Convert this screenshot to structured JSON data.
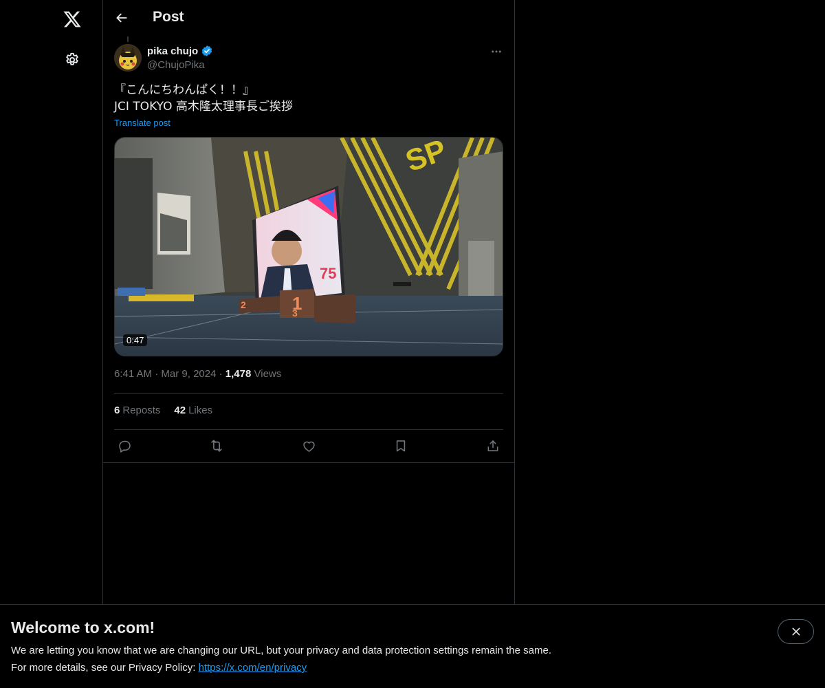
{
  "nav": {
    "logo_icon": "x-logo-icon",
    "settings_icon": "gear-icon"
  },
  "header": {
    "title": "Post"
  },
  "post": {
    "author_name": "pika chujo",
    "author_handle": "@ChujoPika",
    "verified": true,
    "text_line1": "『こんにちわんぱく！！』",
    "text_line2": "JCI TOKYO 高木隆太理事長ご挨拶",
    "translate_label": "Translate post",
    "video_duration": "0:47",
    "time": "6:41 AM",
    "date": "Mar 9, 2024",
    "views_count": "1,478",
    "views_label": "Views",
    "reposts_count": "6",
    "reposts_label": "Reposts",
    "likes_count": "42",
    "likes_label": "Likes",
    "separator": "·"
  },
  "actions": [
    "reply-icon",
    "repost-icon",
    "like-icon",
    "bookmark-icon",
    "share-icon"
  ],
  "colors": {
    "accent": "#1d9bf0",
    "verified": "#1d9bf0",
    "muted_text": "#71767b",
    "border": "#2f3336"
  },
  "banner": {
    "title": "Welcome to x.com!",
    "line1": "We are letting you know that we are changing our URL, but your privacy and data protection settings remain the same.",
    "line2_prefix": "For more details, see our Privacy Policy:",
    "privacy_link": "https://x.com/en/privacy"
  }
}
